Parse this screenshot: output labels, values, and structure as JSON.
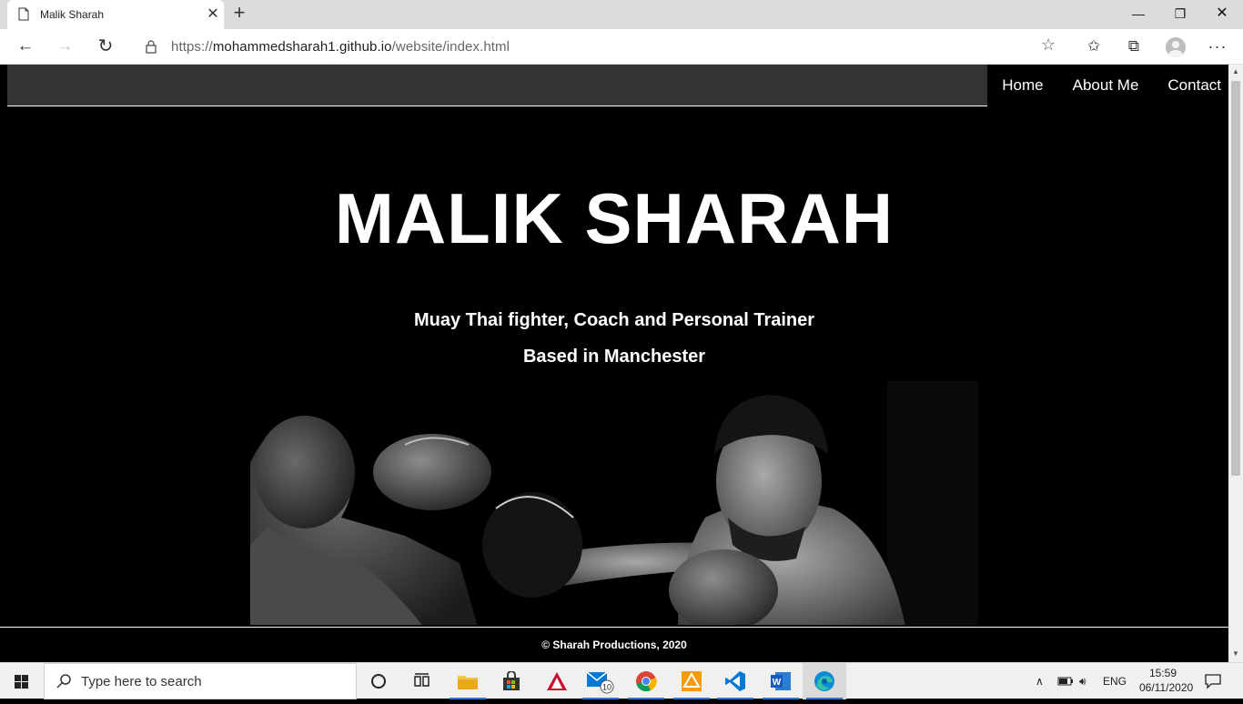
{
  "browser": {
    "tab_title": "Malik Sharah",
    "url_prefix": "https://",
    "url_host": "mohammedsharah1.github.io",
    "url_path": "/website/index.html"
  },
  "site": {
    "nav": [
      "Home",
      "About Me",
      "Contact"
    ],
    "title": "MALIK SHARAH",
    "subtitle1": "Muay Thai fighter, Coach and Personal Trainer",
    "subtitle2": "Based in Manchester",
    "footer": "© Sharah Productions, 2020"
  },
  "taskbar": {
    "search_placeholder": "Type here to search",
    "mail_badge": "10",
    "language": "ENG",
    "time": "15:59",
    "date": "06/11/2020"
  },
  "colors": {
    "page_bg": "#000000",
    "nav_bg": "#333333",
    "text": "#ffffff",
    "accent_blue": "#0078d4"
  }
}
